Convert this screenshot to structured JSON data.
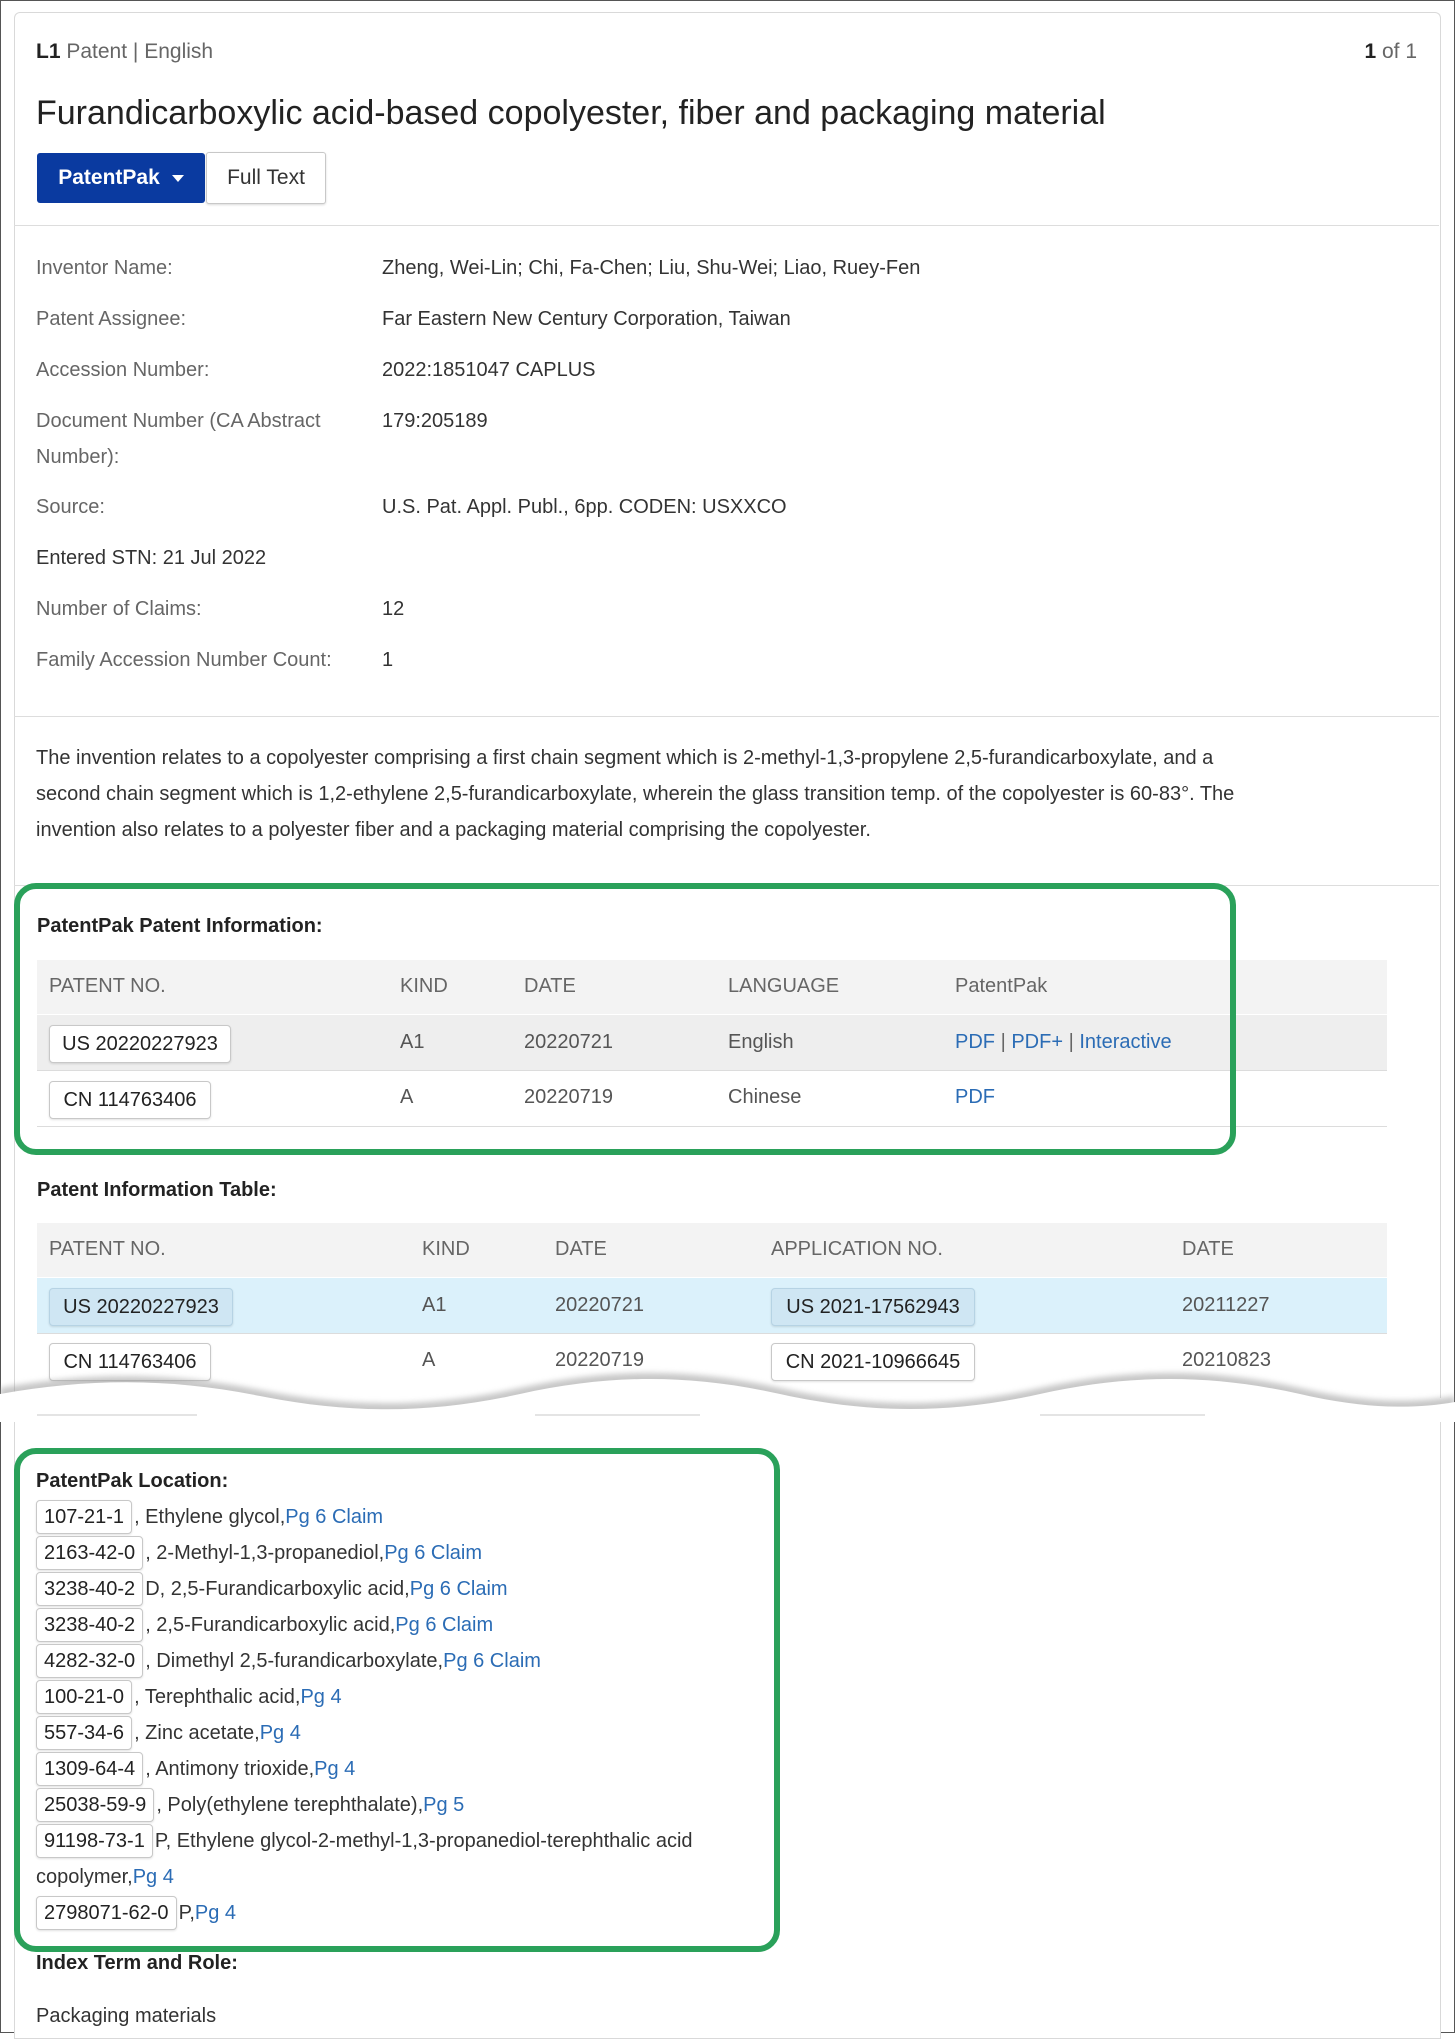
{
  "header": {
    "set_label": "L1",
    "doc_type": "Patent",
    "divider": "|",
    "language": "English",
    "pager_current": "1",
    "pager_text": "of 1",
    "title": "Furandicarboxylic acid-based copolyester, fiber and packaging material",
    "btn_patentpak": "PatentPak",
    "btn_fulltext": "Full Text"
  },
  "details": {
    "inventor_label": "Inventor Name:",
    "inventor_value": "Zheng, Wei-Lin; Chi, Fa-Chen; Liu, Shu-Wei; Liao, Ruey-Fen",
    "assignee_label": "Patent Assignee:",
    "assignee_value": "Far Eastern New Century Corporation, Taiwan",
    "accession_label": "Accession Number:",
    "accession_value": "2022:1851047 CAPLUS",
    "docnum_label_1": "Document Number (CA Abstract",
    "docnum_label_2": "Number):",
    "docnum_value": "179:205189",
    "source_label": "Source:",
    "source_value": "U.S. Pat. Appl. Publ., 6pp. CODEN: USXXCO",
    "entered_stn": "Entered STN: 21 Jul 2022",
    "claims_label": "Number of Claims:",
    "claims_value": "12",
    "family_label": "Family Accession Number Count:",
    "family_value": "1"
  },
  "abstract": {
    "line1": "The invention relates to a copolyester comprising a first chain segment which is 2-methyl-1,3-propylene 2,5-furandicarboxylate, and a",
    "line2": "second chain segment which is 1,2-ethylene 2,5-furandicarboxylate, wherein the glass transition temp. of the copolyester is 60-83°. The",
    "line3": "invention also relates to a polyester fiber and a packaging material comprising the copolyester."
  },
  "patentpak_info": {
    "heading": "PatentPak Patent Information:",
    "columns": [
      "PATENT NO.",
      "KIND",
      "DATE",
      "LANGUAGE",
      "PatentPak"
    ],
    "rows": [
      {
        "patent_no": "US 20220227923",
        "kind": "A1",
        "date": "20220721",
        "language": "English",
        "pdf": "PDF",
        "pdfplus": "PDF+",
        "interactive": "Interactive",
        "sep": "|"
      },
      {
        "patent_no": "CN 114763406",
        "kind": "A",
        "date": "20220719",
        "language": "Chinese",
        "pdf": "PDF"
      }
    ]
  },
  "patent_info_table": {
    "heading": "Patent Information Table:",
    "columns": [
      "PATENT NO.",
      "KIND",
      "DATE",
      "APPLICATION NO.",
      "DATE"
    ],
    "rows": [
      {
        "patent_no": "US 20220227923",
        "kind": "A1",
        "date": "20220721",
        "app_no": "US 2021-17562943",
        "app_date": "20211227"
      },
      {
        "patent_no": "CN 114763406",
        "kind": "A",
        "date": "20220719",
        "app_no": "CN 2021-10966645",
        "app_date": "20210823"
      }
    ]
  },
  "location": {
    "heading": "PatentPak Location:",
    "items": [
      {
        "cas": "107-21-1",
        "text": ", Ethylene glycol, ",
        "link": "Pg 6 Claim"
      },
      {
        "cas": "2163-42-0",
        "text": ", 2-Methyl-1,3-propanediol, ",
        "link": "Pg 6 Claim"
      },
      {
        "cas": "3238-40-2",
        "text": "D, 2,5-Furandicarboxylic acid, ",
        "link": "Pg 6 Claim"
      },
      {
        "cas": "3238-40-2",
        "text": ", 2,5-Furandicarboxylic acid, ",
        "link": "Pg 6 Claim"
      },
      {
        "cas": "4282-32-0",
        "text": ", Dimethyl 2,5-furandicarboxylate, ",
        "link": "Pg 6 Claim"
      },
      {
        "cas": "100-21-0",
        "text": ", Terephthalic acid, ",
        "link": "Pg 4"
      },
      {
        "cas": "557-34-6",
        "text": ", Zinc acetate, ",
        "link": "Pg 4"
      },
      {
        "cas": "1309-64-4",
        "text": ", Antimony trioxide, ",
        "link": "Pg 4"
      },
      {
        "cas": "25038-59-9",
        "text": ", Poly(ethylene terephthalate), ",
        "link": "Pg 5"
      },
      {
        "cas": "91198-73-1",
        "text": "P, Ethylene glycol-2-methyl-1,3-propanediol-terephthalic acid",
        "link": ""
      },
      {
        "cas": "",
        "text": "copolymer, ",
        "link": "Pg 4"
      },
      {
        "cas": "2798071-62-0",
        "text": "P, ",
        "link": "Pg 4"
      }
    ]
  },
  "index_terms": {
    "heading": "Index Term and Role:",
    "first_term": "Packaging materials"
  },
  "colors": {
    "primary_button": "#0a3aa0",
    "highlight_box": "#2aa15a",
    "link": "#2b6cb5",
    "selected_row": "#dbf1fb"
  }
}
